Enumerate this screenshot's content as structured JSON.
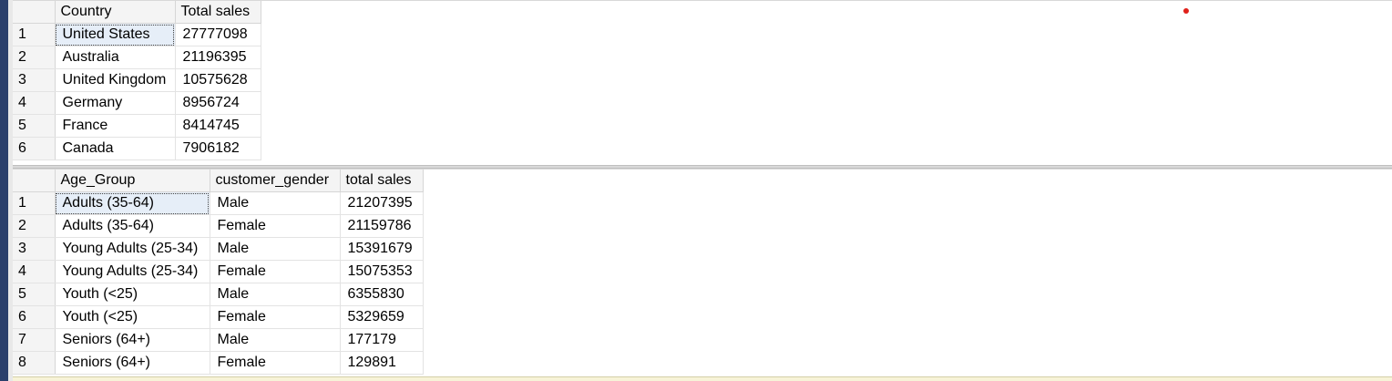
{
  "results": [
    {
      "columns": [
        "Country",
        "Total sales"
      ],
      "rows": [
        [
          "1",
          "United States",
          "27777098"
        ],
        [
          "2",
          "Australia",
          "21196395"
        ],
        [
          "3",
          "United Kingdom",
          "10575628"
        ],
        [
          "4",
          "Germany",
          "8956724"
        ],
        [
          "5",
          "France",
          "8414745"
        ],
        [
          "6",
          "Canada",
          "7906182"
        ]
      ]
    },
    {
      "columns": [
        "Age_Group",
        "customer_gender",
        "total sales"
      ],
      "rows": [
        [
          "1",
          "Adults (35-64)",
          "Male",
          "21207395"
        ],
        [
          "2",
          "Adults (35-64)",
          "Female",
          "21159786"
        ],
        [
          "3",
          "Young Adults (25-34)",
          "Male",
          "15391679"
        ],
        [
          "4",
          "Young Adults (25-34)",
          "Female",
          "15075353"
        ],
        [
          "5",
          "Youth (<25)",
          "Male",
          "6355830"
        ],
        [
          "6",
          "Youth (<25)",
          "Female",
          "5329659"
        ],
        [
          "7",
          "Seniors (64+)",
          "Male",
          "177179"
        ],
        [
          "8",
          "Seniors (64+)",
          "Female",
          "129891"
        ]
      ]
    }
  ],
  "colors": {
    "indicator_dot": "#e0201a",
    "left_edge": "#2b3f6b"
  }
}
